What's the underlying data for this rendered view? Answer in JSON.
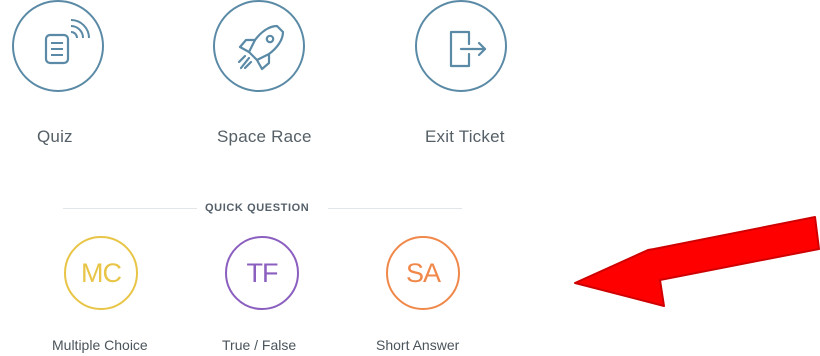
{
  "activities": [
    {
      "label": "Quiz",
      "icon": "quiz-wifi-document-icon"
    },
    {
      "label": "Space Race",
      "icon": "rocket-icon"
    },
    {
      "label": "Exit Ticket",
      "icon": "exit-door-icon"
    }
  ],
  "quick_question": {
    "title": "QUICK QUESTION",
    "options": [
      {
        "abbr": "MC",
        "label": "Multiple Choice",
        "color": "#e8c547"
      },
      {
        "abbr": "TF",
        "label": "True / False",
        "color": "#8b5fbf"
      },
      {
        "abbr": "SA",
        "label": "Short Answer",
        "color": "#f0884a"
      }
    ]
  },
  "colors": {
    "activity_stroke": "#5a8aa6",
    "arrow": "#ff0000"
  }
}
